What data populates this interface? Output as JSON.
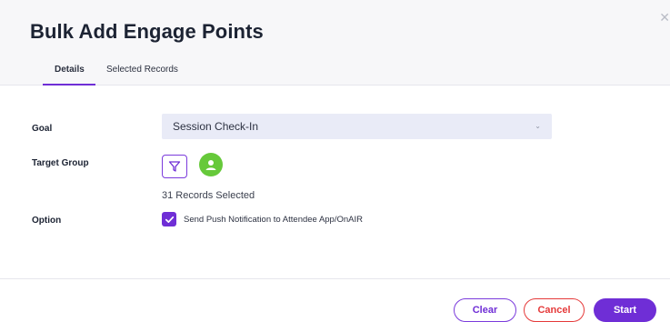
{
  "dialog": {
    "title": "Bulk Add Engage Points",
    "close_icon": "close-icon"
  },
  "tabs": [
    {
      "label": "Details",
      "active": true
    },
    {
      "label": "Selected Records",
      "active": false
    }
  ],
  "form": {
    "goal": {
      "label": "Goal",
      "value": "Session Check-In"
    },
    "target_group": {
      "label": "Target Group",
      "records_text": "31 Records Selected"
    },
    "option": {
      "label": "Option",
      "checkbox_label": "Send Push Notification to Attendee App/OnAIR",
      "checked": true
    }
  },
  "footer": {
    "clear_label": "Clear",
    "cancel_label": "Cancel",
    "start_label": "Start"
  },
  "colors": {
    "accent": "#6f2ed6",
    "danger": "#e53a3a",
    "avatar": "#66c93a",
    "select_bg": "#e9ebf7"
  }
}
